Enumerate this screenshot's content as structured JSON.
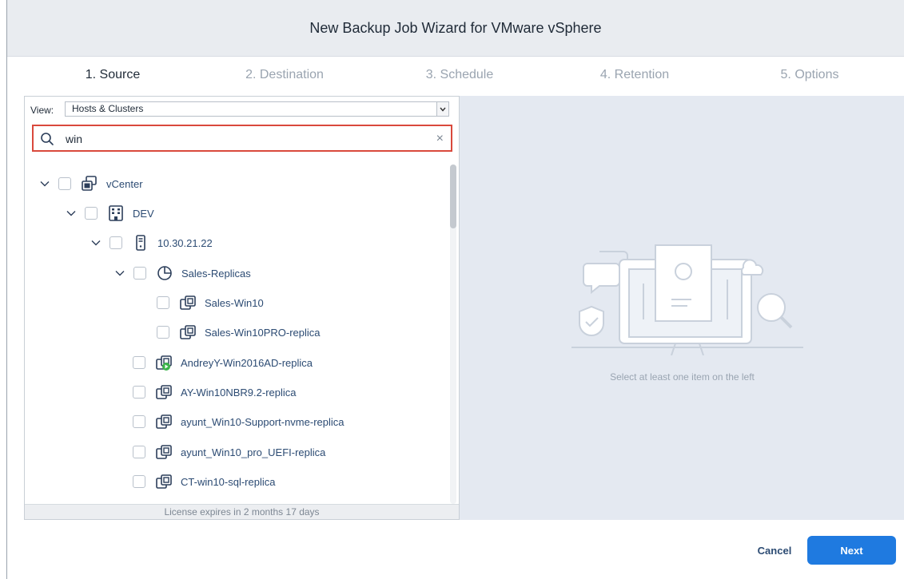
{
  "window": {
    "title": "New Backup Job Wizard for VMware vSphere"
  },
  "steps": [
    {
      "label": "1. Source",
      "active": true
    },
    {
      "label": "2. Destination",
      "active": false
    },
    {
      "label": "3. Schedule",
      "active": false
    },
    {
      "label": "4. Retention",
      "active": false
    },
    {
      "label": "5. Options",
      "active": false
    }
  ],
  "view": {
    "label": "View:",
    "selected": "Hosts & Clusters"
  },
  "search": {
    "value": "win",
    "clear_icon": "close-icon"
  },
  "tree": [
    {
      "label": "vCenter",
      "icon": "vcenter-icon",
      "level": 0,
      "expanded": true
    },
    {
      "label": "DEV",
      "icon": "datacenter-icon",
      "level": 1,
      "expanded": true
    },
    {
      "label": "10.30.21.22",
      "icon": "host-icon",
      "level": 2,
      "expanded": true
    },
    {
      "label": "Sales-Replicas",
      "icon": "resource-pool-icon",
      "level": 3,
      "expanded": true
    },
    {
      "label": "Sales-Win10",
      "icon": "vm-icon",
      "level": 4
    },
    {
      "label": "Sales-Win10PRO-replica",
      "icon": "vm-icon",
      "level": 4
    },
    {
      "label": "AndreyY-Win2016AD-replica",
      "icon": "vm-running-icon",
      "level": 3
    },
    {
      "label": "AY-Win10NBR9.2-replica",
      "icon": "vm-icon",
      "level": 3
    },
    {
      "label": "ayunt_Win10-Support-nvme-replica",
      "icon": "vm-icon",
      "level": 3
    },
    {
      "label": "ayunt_Win10_pro_UEFI-replica",
      "icon": "vm-icon",
      "level": 3
    },
    {
      "label": "CT-win10-sql-replica",
      "icon": "vm-icon",
      "level": 3
    }
  ],
  "license": {
    "text": "License expires in 2 months 17 days"
  },
  "empty_state": {
    "text": "Select at least one item on the left"
  },
  "buttons": {
    "cancel": "Cancel",
    "next": "Next"
  },
  "colors": {
    "accent": "#1f7ae0",
    "search_highlight": "#d9493c",
    "running_badge": "#3cb44a"
  }
}
